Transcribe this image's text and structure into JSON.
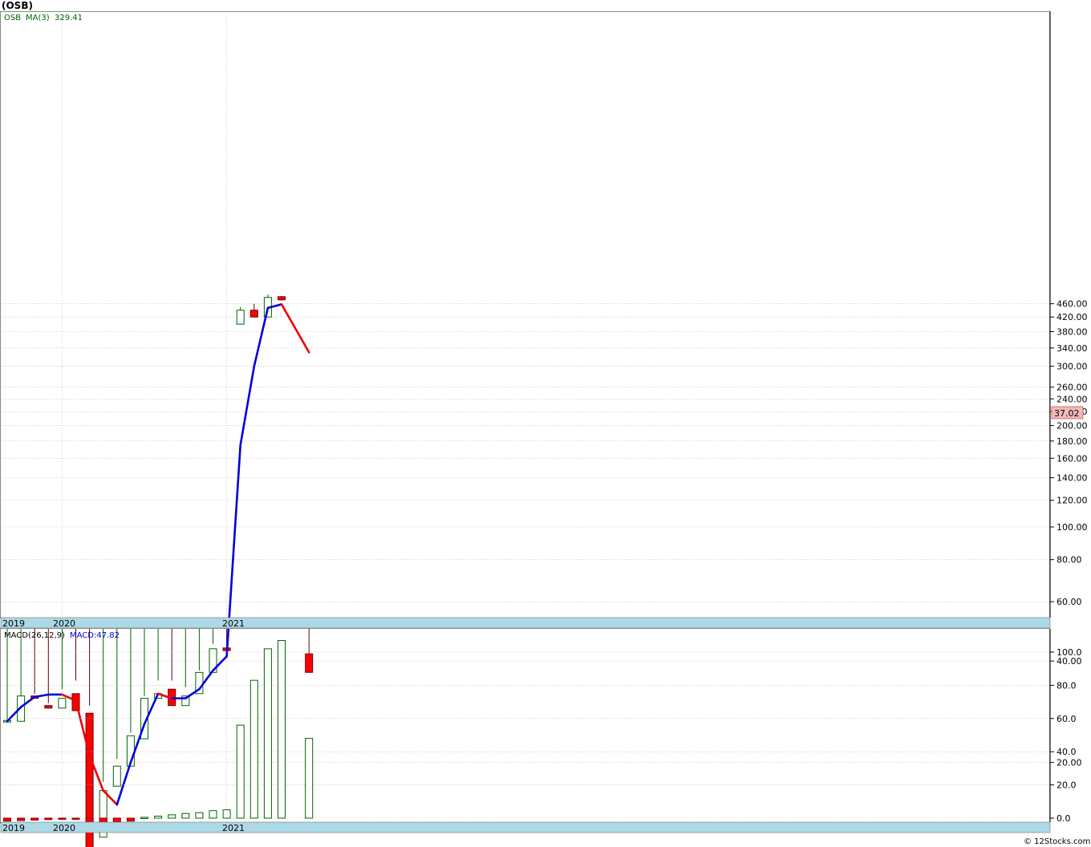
{
  "title": "(OSB)",
  "credit": "© 12Stocks.com",
  "colors": {
    "up": "#006400",
    "down": "#ff0000",
    "ma_up": "#0000dd",
    "ma_down": "#ee0000",
    "axis_band": "#add8e6",
    "grid": "#b0b0b0",
    "last_bg": "#f4b8b8",
    "macd_legend": "#0000cc"
  },
  "price_panel": {
    "legend": {
      "symbol": "OSB",
      "ma_label": "MA(3)",
      "ma_value": "329.41"
    },
    "last_price_label": "37.02"
  },
  "macd_panel": {
    "legend": {
      "params": "MACD(26,12,9)",
      "value_label": "MACD:47.82"
    }
  },
  "x_axis": {
    "years": [
      "2019",
      "2020",
      "2021"
    ]
  },
  "chart_data": [
    {
      "type": "candlestick",
      "scale": "log",
      "ylim": [
        10,
        520
      ],
      "yticks": [
        20,
        40,
        60,
        80,
        100,
        120,
        140,
        160,
        180,
        200,
        220,
        240,
        260,
        300,
        340,
        380,
        420,
        460
      ],
      "ytick_labels": [
        "20.00",
        "40.00",
        "60.00",
        "80.00",
        "100.00",
        "120.00",
        "140.00",
        "160.00",
        "180.00",
        "200.00",
        "220.00",
        "240.00",
        "260.00",
        "300.00",
        "340.00",
        "380.00",
        "420.00",
        "460.00"
      ],
      "x": [
        "2019-12",
        "2020-01",
        "2020-02",
        "2020-03",
        "2020-04",
        "2020-05",
        "2020-06",
        "2020-07",
        "2020-08",
        "2020-09",
        "2020-10",
        "2020-11",
        "2020-12",
        "2021-01",
        "2021-02",
        "2021-03",
        "2021-04",
        "2021-05",
        "2021-06",
        "2021-07",
        "2021-08",
        "2021-09",
        "2021-10"
      ],
      "ohlc": [
        [
          26.5,
          26.8,
          25.5,
          26.5
        ],
        [
          26.5,
          31.5,
          23.5,
          31.5
        ],
        [
          31.5,
          32.0,
          30.0,
          31.0
        ],
        [
          29.5,
          30.0,
          27.5,
          29.0
        ],
        [
          29.0,
          33.0,
          27.5,
          31.0
        ],
        [
          32.0,
          35.0,
          28.0,
          28.5
        ],
        [
          28.0,
          29.5,
          10.0,
          11.0
        ],
        [
          12.0,
          17.5,
          9.5,
          16.5
        ],
        [
          17.0,
          20.5,
          14.0,
          19.5
        ],
        [
          19.5,
          24.5,
          19.0,
          24.0
        ],
        [
          23.5,
          31.5,
          22.0,
          31.0
        ],
        [
          31.0,
          35.0,
          30.0,
          32.0
        ],
        [
          33.0,
          35.0,
          28.5,
          29.5
        ],
        [
          29.5,
          33.5,
          29.0,
          31.5
        ],
        [
          32.0,
          37.5,
          31.0,
          37.0
        ],
        [
          37.0,
          45.0,
          36.5,
          43.5
        ],
        [
          43.5,
          43.5,
          43.0,
          43.2
        ],
        [
          400.0,
          450.0,
          400.0,
          440.0
        ],
        [
          440.0,
          460.0,
          420.0,
          420.0
        ],
        [
          420.0,
          490.0,
          420.0,
          480.0
        ],
        [
          480.0,
          485.0,
          470.0,
          475.0
        ],
        [
          null,
          null,
          null,
          null
        ],
        [
          42.0,
          42.0,
          35.5,
          37.02
        ]
      ],
      "ma3": [
        26.5,
        29.2,
        31.3,
        31.8,
        31.8,
        30.5,
        21.0,
        16.5,
        15.0,
        20.0,
        26.0,
        32.0,
        31.0,
        31.0,
        33.0,
        37.5,
        41.3,
        175.0,
        300.0,
        447.0,
        458.0,
        null,
        330.0
      ]
    },
    {
      "type": "bar",
      "ylim": [
        -1,
        106
      ],
      "yticks": [
        0,
        20,
        40,
        60,
        80,
        100
      ],
      "ytick_labels": [
        "0.0",
        "20.0",
        "40.0",
        "60.0",
        "80.0",
        "100.0"
      ],
      "x": [
        "2019-12",
        "2020-01",
        "2020-02",
        "2020-03",
        "2020-04",
        "2020-05",
        "2020-06",
        "2020-07",
        "2020-08",
        "2020-09",
        "2020-10",
        "2020-11",
        "2020-12",
        "2021-01",
        "2021-02",
        "2021-03",
        "2021-04",
        "2021-05",
        "2021-06",
        "2021-07",
        "2021-08",
        "2021-09",
        "2021-10"
      ],
      "values": [
        -1.8,
        -1.5,
        -1.2,
        -0.9,
        -0.5,
        -0.4,
        -2.5,
        -2.5,
        -2.3,
        -1.8,
        0.5,
        1.2,
        2.0,
        2.8,
        3.3,
        4.5,
        5.0,
        56.0,
        83.0,
        102.0,
        107.0,
        null,
        48.0
      ]
    }
  ]
}
